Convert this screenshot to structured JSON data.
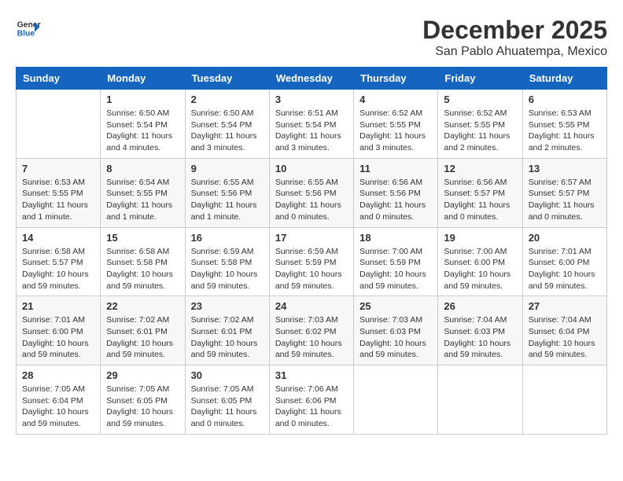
{
  "header": {
    "logo_line1": "General",
    "logo_line2": "Blue",
    "title": "December 2025",
    "subtitle": "San Pablo Ahuatempa, Mexico"
  },
  "columns": [
    "Sunday",
    "Monday",
    "Tuesday",
    "Wednesday",
    "Thursday",
    "Friday",
    "Saturday"
  ],
  "weeks": [
    [
      {
        "day": "",
        "info": ""
      },
      {
        "day": "1",
        "info": "Sunrise: 6:50 AM\nSunset: 5:54 PM\nDaylight: 11 hours\nand 4 minutes."
      },
      {
        "day": "2",
        "info": "Sunrise: 6:50 AM\nSunset: 5:54 PM\nDaylight: 11 hours\nand 3 minutes."
      },
      {
        "day": "3",
        "info": "Sunrise: 6:51 AM\nSunset: 5:54 PM\nDaylight: 11 hours\nand 3 minutes."
      },
      {
        "day": "4",
        "info": "Sunrise: 6:52 AM\nSunset: 5:55 PM\nDaylight: 11 hours\nand 3 minutes."
      },
      {
        "day": "5",
        "info": "Sunrise: 6:52 AM\nSunset: 5:55 PM\nDaylight: 11 hours\nand 2 minutes."
      },
      {
        "day": "6",
        "info": "Sunrise: 6:53 AM\nSunset: 5:55 PM\nDaylight: 11 hours\nand 2 minutes."
      }
    ],
    [
      {
        "day": "7",
        "info": "Sunrise: 6:53 AM\nSunset: 5:55 PM\nDaylight: 11 hours\nand 1 minute."
      },
      {
        "day": "8",
        "info": "Sunrise: 6:54 AM\nSunset: 5:55 PM\nDaylight: 11 hours\nand 1 minute."
      },
      {
        "day": "9",
        "info": "Sunrise: 6:55 AM\nSunset: 5:56 PM\nDaylight: 11 hours\nand 1 minute."
      },
      {
        "day": "10",
        "info": "Sunrise: 6:55 AM\nSunset: 5:56 PM\nDaylight: 11 hours\nand 0 minutes."
      },
      {
        "day": "11",
        "info": "Sunrise: 6:56 AM\nSunset: 5:56 PM\nDaylight: 11 hours\nand 0 minutes."
      },
      {
        "day": "12",
        "info": "Sunrise: 6:56 AM\nSunset: 5:57 PM\nDaylight: 11 hours\nand 0 minutes."
      },
      {
        "day": "13",
        "info": "Sunrise: 6:57 AM\nSunset: 5:57 PM\nDaylight: 11 hours\nand 0 minutes."
      }
    ],
    [
      {
        "day": "14",
        "info": "Sunrise: 6:58 AM\nSunset: 5:57 PM\nDaylight: 10 hours\nand 59 minutes."
      },
      {
        "day": "15",
        "info": "Sunrise: 6:58 AM\nSunset: 5:58 PM\nDaylight: 10 hours\nand 59 minutes."
      },
      {
        "day": "16",
        "info": "Sunrise: 6:59 AM\nSunset: 5:58 PM\nDaylight: 10 hours\nand 59 minutes."
      },
      {
        "day": "17",
        "info": "Sunrise: 6:59 AM\nSunset: 5:59 PM\nDaylight: 10 hours\nand 59 minutes."
      },
      {
        "day": "18",
        "info": "Sunrise: 7:00 AM\nSunset: 5:59 PM\nDaylight: 10 hours\nand 59 minutes."
      },
      {
        "day": "19",
        "info": "Sunrise: 7:00 AM\nSunset: 6:00 PM\nDaylight: 10 hours\nand 59 minutes."
      },
      {
        "day": "20",
        "info": "Sunrise: 7:01 AM\nSunset: 6:00 PM\nDaylight: 10 hours\nand 59 minutes."
      }
    ],
    [
      {
        "day": "21",
        "info": "Sunrise: 7:01 AM\nSunset: 6:00 PM\nDaylight: 10 hours\nand 59 minutes."
      },
      {
        "day": "22",
        "info": "Sunrise: 7:02 AM\nSunset: 6:01 PM\nDaylight: 10 hours\nand 59 minutes."
      },
      {
        "day": "23",
        "info": "Sunrise: 7:02 AM\nSunset: 6:01 PM\nDaylight: 10 hours\nand 59 minutes."
      },
      {
        "day": "24",
        "info": "Sunrise: 7:03 AM\nSunset: 6:02 PM\nDaylight: 10 hours\nand 59 minutes."
      },
      {
        "day": "25",
        "info": "Sunrise: 7:03 AM\nSunset: 6:03 PM\nDaylight: 10 hours\nand 59 minutes."
      },
      {
        "day": "26",
        "info": "Sunrise: 7:04 AM\nSunset: 6:03 PM\nDaylight: 10 hours\nand 59 minutes."
      },
      {
        "day": "27",
        "info": "Sunrise: 7:04 AM\nSunset: 6:04 PM\nDaylight: 10 hours\nand 59 minutes."
      }
    ],
    [
      {
        "day": "28",
        "info": "Sunrise: 7:05 AM\nSunset: 6:04 PM\nDaylight: 10 hours\nand 59 minutes."
      },
      {
        "day": "29",
        "info": "Sunrise: 7:05 AM\nSunset: 6:05 PM\nDaylight: 10 hours\nand 59 minutes."
      },
      {
        "day": "30",
        "info": "Sunrise: 7:05 AM\nSunset: 6:05 PM\nDaylight: 11 hours\nand 0 minutes."
      },
      {
        "day": "31",
        "info": "Sunrise: 7:06 AM\nSunset: 6:06 PM\nDaylight: 11 hours\nand 0 minutes."
      },
      {
        "day": "",
        "info": ""
      },
      {
        "day": "",
        "info": ""
      },
      {
        "day": "",
        "info": ""
      }
    ]
  ]
}
